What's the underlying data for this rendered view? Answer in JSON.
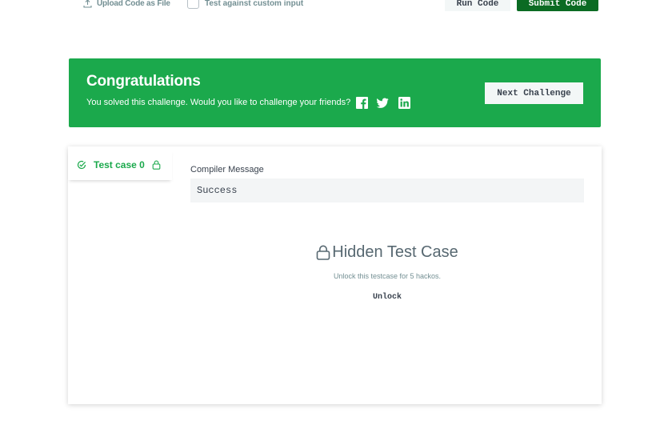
{
  "toolbar": {
    "upload_label": "Upload Code as File",
    "custom_input_label": "Test against custom input",
    "custom_input_checked": false,
    "run_label": "Run Code",
    "submit_label": "Submit Code"
  },
  "banner": {
    "title": "Congratulations",
    "subtitle": "You solved this challenge. Would you like to challenge your friends?",
    "share_icons": [
      "facebook-icon",
      "twitter-icon",
      "linkedin-icon"
    ],
    "next_label": "Next Challenge",
    "color": "#1ba94c"
  },
  "results": {
    "tabs": [
      {
        "label": "Test case 0",
        "status": "passed",
        "locked": true
      }
    ],
    "compiler_label": "Compiler Message",
    "compiler_message": "Success",
    "hidden_title": "Hidden Test Case",
    "hidden_sub": "Unlock this testcase for 5 hackos.",
    "unlock_label": "Unlock"
  }
}
